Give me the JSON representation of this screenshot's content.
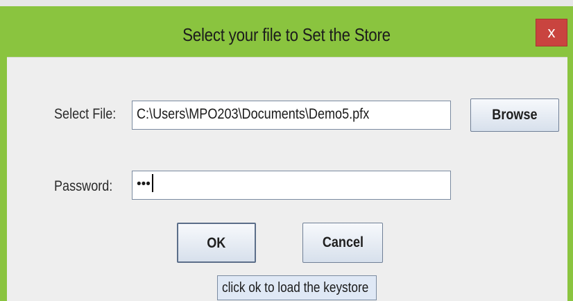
{
  "window": {
    "title": "Select your file to Set the Store",
    "close_glyph": "x",
    "accent_color": "#8ac43f",
    "close_color": "#c9443f"
  },
  "form": {
    "file_label": "Select File:",
    "file_value": "C:\\Users\\MPO203\\Documents\\Demo5.pfx",
    "password_label": "Password:",
    "password_masked": "•••"
  },
  "buttons": {
    "browse": "Browse",
    "ok": "OK",
    "cancel": "Cancel"
  },
  "tooltip": {
    "text": "click ok to load the keystore"
  }
}
